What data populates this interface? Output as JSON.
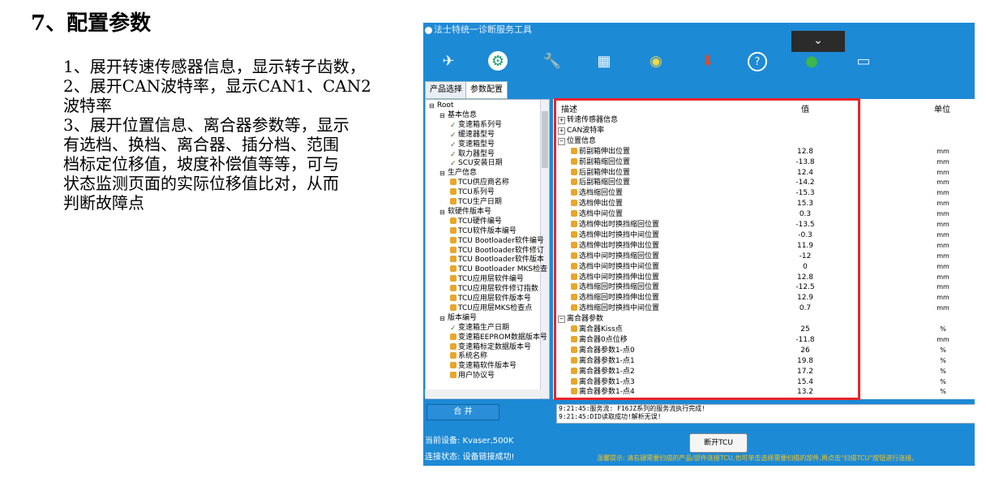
{
  "slide": {
    "title": "7、配置参数",
    "points": [
      "1、展开转速传感器信息，显示转子齿数，",
      "2、展开CAN波特率，显示CAN1、CAN2",
      "波特率",
      "3、展开位置信息、离合器参数等，显示",
      "有选档、换档、离合器、插分档、范围",
      "档标定位移值，坡度补偿值等等，可与",
      "状态监测页面的实际位移值比对，从而",
      "判断故障点"
    ]
  },
  "app": {
    "title": "法士特统一诊断服务工具",
    "dropdown_icon": "chevron-down-icon",
    "toolbar_icons": [
      "satellite-icon",
      "gear-icon",
      "tools-icon",
      "calculator-icon",
      "dial-icon",
      "download-icon",
      "help-icon",
      "globe-icon",
      "monitor-icon"
    ],
    "tabs": [
      "产品选择",
      "参数配置"
    ],
    "tree": [
      {
        "label": "Root",
        "level": 0,
        "icon": "folder"
      },
      {
        "label": "基本信息",
        "level": 1,
        "icon": "folder"
      },
      {
        "label": "变速箱系列号",
        "level": 2,
        "icon": "check"
      },
      {
        "label": "缓速器型号",
        "level": 2,
        "icon": "check"
      },
      {
        "label": "变速箱型号",
        "level": 2,
        "icon": "check"
      },
      {
        "label": "取力器型号",
        "level": 2,
        "icon": "check"
      },
      {
        "label": "SCU安装日期",
        "level": 2,
        "icon": "check"
      },
      {
        "label": "生产信息",
        "level": 1,
        "icon": "folder"
      },
      {
        "label": "TCU供应商名称",
        "level": 2,
        "icon": "lock"
      },
      {
        "label": "TCU系列号",
        "level": 2,
        "icon": "lock"
      },
      {
        "label": "TCU生产日期",
        "level": 2,
        "icon": "lock"
      },
      {
        "label": "软硬件版本号",
        "level": 1,
        "icon": "folder"
      },
      {
        "label": "TCU硬件编号",
        "level": 2,
        "icon": "lock"
      },
      {
        "label": "TCU软件版本编号",
        "level": 2,
        "icon": "lock"
      },
      {
        "label": "TCU Bootloader软件编号",
        "level": 2,
        "icon": "lock"
      },
      {
        "label": "TCU Bootloader软件修订",
        "level": 2,
        "icon": "lock"
      },
      {
        "label": "TCU Bootloader软件版本",
        "level": 2,
        "icon": "lock"
      },
      {
        "label": "TCU Bootloader MKS检查",
        "level": 2,
        "icon": "lock"
      },
      {
        "label": "TCU应用层软件编号",
        "level": 2,
        "icon": "lock"
      },
      {
        "label": "TCU应用层软件修订指数",
        "level": 2,
        "icon": "lock"
      },
      {
        "label": "TCU应用层软件版本号",
        "level": 2,
        "icon": "lock"
      },
      {
        "label": "TCU应用层MKS检查点",
        "level": 2,
        "icon": "lock"
      },
      {
        "label": "版本编号",
        "level": 1,
        "icon": "folder"
      },
      {
        "label": "变速箱生产日期",
        "level": 2,
        "icon": "check"
      },
      {
        "label": "变速箱EEPROM数据版本号",
        "level": 2,
        "icon": "lock"
      },
      {
        "label": "变速箱标定数据版本号",
        "level": 2,
        "icon": "lock"
      },
      {
        "label": "系统名称",
        "level": 2,
        "icon": "lock"
      },
      {
        "label": "变速箱软件版本号",
        "level": 2,
        "icon": "lock"
      },
      {
        "label": "用户协议号",
        "level": 2,
        "icon": "lock"
      }
    ],
    "merge_label": "合 并",
    "table": {
      "headers": {
        "desc": "描述",
        "value": "值",
        "unit": "单位"
      },
      "rows": [
        {
          "desc": "转速传感器信息",
          "value": "",
          "unit": "",
          "type": "collapsed"
        },
        {
          "desc": "CAN波特率",
          "value": "",
          "unit": "",
          "type": "collapsed"
        },
        {
          "desc": "位置信息",
          "value": "",
          "unit": "",
          "type": "group"
        },
        {
          "desc": "前副箱伸出位置",
          "value": "12.8",
          "unit": "mm",
          "type": "item"
        },
        {
          "desc": "前副箱缩回位置",
          "value": "-13.8",
          "unit": "mm",
          "type": "item"
        },
        {
          "desc": "后副箱伸出位置",
          "value": "12.4",
          "unit": "mm",
          "type": "item"
        },
        {
          "desc": "后副箱缩回位置",
          "value": "-14.2",
          "unit": "mm",
          "type": "item"
        },
        {
          "desc": "选档缩回位置",
          "value": "-15.3",
          "unit": "mm",
          "type": "item"
        },
        {
          "desc": "选档伸出位置",
          "value": "15.3",
          "unit": "mm",
          "type": "item"
        },
        {
          "desc": "选档中间位置",
          "value": "0.3",
          "unit": "mm",
          "type": "item"
        },
        {
          "desc": "选档伸出时换挡缩回位置",
          "value": "-13.5",
          "unit": "mm",
          "type": "item"
        },
        {
          "desc": "选档伸出时换挡中间位置",
          "value": "-0.3",
          "unit": "mm",
          "type": "item"
        },
        {
          "desc": "选档伸出时换挡伸出位置",
          "value": "11.9",
          "unit": "mm",
          "type": "item"
        },
        {
          "desc": "选档中间时换挡缩回位置",
          "value": "-12",
          "unit": "mm",
          "type": "item"
        },
        {
          "desc": "选档中间时换挡中间位置",
          "value": "0",
          "unit": "mm",
          "type": "item"
        },
        {
          "desc": "选档中间时换挡伸出位置",
          "value": "12.8",
          "unit": "mm",
          "type": "item"
        },
        {
          "desc": "选档缩回时换挡缩回位置",
          "value": "-12.5",
          "unit": "mm",
          "type": "item"
        },
        {
          "desc": "选档缩回时换挡伸出位置",
          "value": "12.9",
          "unit": "mm",
          "type": "item"
        },
        {
          "desc": "选档缩回时换挡中间位置",
          "value": "0.7",
          "unit": "mm",
          "type": "item"
        },
        {
          "desc": "离合器参数",
          "value": "",
          "unit": "",
          "type": "group"
        },
        {
          "desc": "离合器Kiss点",
          "value": "25",
          "unit": "%",
          "type": "item"
        },
        {
          "desc": "离合器0点位移",
          "value": "-11.8",
          "unit": "mm",
          "type": "item"
        },
        {
          "desc": "离合器参数1-点0",
          "value": "26",
          "unit": "%",
          "type": "item"
        },
        {
          "desc": "离合器参数1-点1",
          "value": "19.8",
          "unit": "%",
          "type": "item"
        },
        {
          "desc": "离合器参数1-点2",
          "value": "17.2",
          "unit": "%",
          "type": "item"
        },
        {
          "desc": "离合器参数1-点3",
          "value": "15.4",
          "unit": "%",
          "type": "item"
        },
        {
          "desc": "离合器参数1-点4",
          "value": "13.2",
          "unit": "%",
          "type": "item"
        }
      ]
    },
    "log": [
      "9:21:45:服务流: F16JZ系列的服务流执行完成!",
      "9:21:45:DID读取成功!解析无误!"
    ],
    "status": {
      "device": "当前设备: Kvaser,500K",
      "connection": "连接状态: 设备链接成功!"
    },
    "open_tcu_label": "断开TCU",
    "hint": "温馨提示: 请右键需要扫描的产品/部件连接TCU,也可单击选择需要扫描的部件,再点击\"扫描TCU\"按钮进行连接。",
    "colors": {
      "window": "#1d8ad6",
      "highlight": "#e8262a",
      "lock": "#e8a62b"
    }
  }
}
